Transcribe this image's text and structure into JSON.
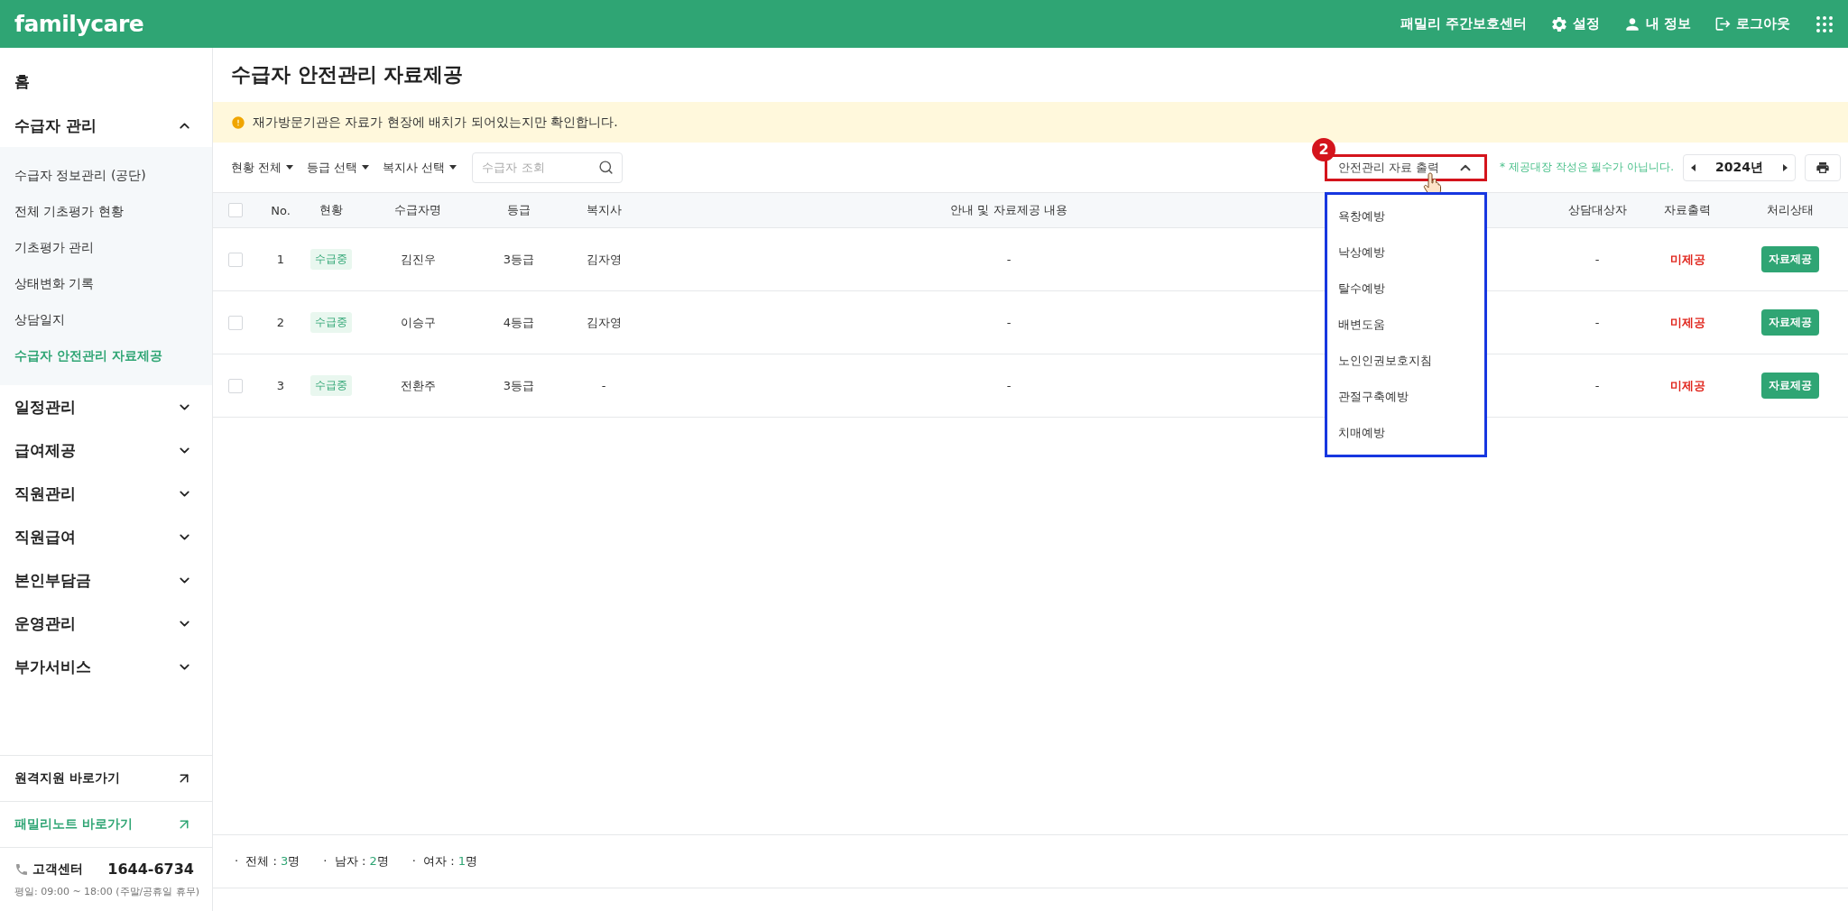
{
  "header": {
    "logo": "familycare",
    "center_name": "패밀리 주간보호센터",
    "actions": [
      {
        "kind": "settings",
        "label": "설정"
      },
      {
        "kind": "profile",
        "label": "내 정보"
      },
      {
        "kind": "logout",
        "label": "로그아웃"
      }
    ]
  },
  "sidebar": {
    "menu": [
      {
        "kind": "link",
        "label": "홈"
      },
      {
        "kind": "group",
        "label": "수급자 관리",
        "expanded": true,
        "children": [
          {
            "label": "수급자 정보관리 (공단)",
            "selected": false
          },
          {
            "label": "전체 기초평가 현황",
            "selected": false
          },
          {
            "label": "기초평가 관리",
            "selected": false
          },
          {
            "label": "상태변화 기록",
            "selected": false
          },
          {
            "label": "상담일지",
            "selected": false
          },
          {
            "label": "수급자 안전관리 자료제공",
            "selected": true
          }
        ]
      },
      {
        "kind": "group",
        "label": "일정관리",
        "expanded": false
      },
      {
        "kind": "group",
        "label": "급여제공",
        "expanded": false
      },
      {
        "kind": "group",
        "label": "직원관리",
        "expanded": false
      },
      {
        "kind": "group",
        "label": "직원급여",
        "expanded": false
      },
      {
        "kind": "group",
        "label": "본인부담금",
        "expanded": false
      },
      {
        "kind": "group",
        "label": "운영관리",
        "expanded": false
      },
      {
        "kind": "group",
        "label": "부가서비스",
        "expanded": false
      }
    ],
    "shortcuts": [
      {
        "label": "원격지원 바로가기",
        "highlighted": false
      },
      {
        "label": "패밀리노트 바로가기",
        "highlighted": true
      }
    ],
    "support": {
      "label": "고객센터",
      "phone": "1644-6734",
      "hours": "평일: 09:00 ~ 18:00 (주말/공휴일 휴무)"
    }
  },
  "page": {
    "title": "수급자 안전관리 자료제공",
    "notice": "재가방문기관은 자료가 현장에 배치가 되어있는지만 확인합니다."
  },
  "filters": [
    {
      "label": "현황 전체"
    },
    {
      "label": "등급 선택"
    },
    {
      "label": "복지사 선택"
    }
  ],
  "search": {
    "placeholder": "수급자 조회"
  },
  "output_dropdown": {
    "label": "안전관리 자료 출력",
    "expanded": true,
    "badge": "2",
    "options": [
      "욕창예방",
      "낙상예방",
      "탈수예방",
      "배변도움",
      "노인인권보호지침",
      "관절구축예방",
      "치매예방"
    ]
  },
  "note": "* 제공대장 작성은 필수가 아닙니다.",
  "year": "2024년",
  "table": {
    "header_checked": false,
    "columns": [
      "No.",
      "현황",
      "수급자명",
      "등급",
      "복지사",
      "안내 및 자료제공 내용",
      "상담대상자",
      "자료출력",
      "처리상태"
    ],
    "rows": [
      {
        "checked": false,
        "no": "1",
        "status": "수급중",
        "name": "김진우",
        "grade": "3등급",
        "worker": "김자영",
        "content": "-",
        "counsel": "-",
        "output": "미제공",
        "action": "자료제공"
      },
      {
        "checked": false,
        "no": "2",
        "status": "수급중",
        "name": "이승구",
        "grade": "4등급",
        "worker": "김자영",
        "content": "-",
        "counsel": "-",
        "output": "미제공",
        "action": "자료제공"
      },
      {
        "checked": false,
        "no": "3",
        "status": "수급중",
        "name": "전환주",
        "grade": "3등급",
        "worker": "-",
        "content": "-",
        "counsel": "-",
        "output": "미제공",
        "action": "자료제공"
      }
    ]
  },
  "summary": [
    {
      "bullet": "·",
      "label": "전체 :",
      "count": "3",
      "unit": "명"
    },
    {
      "bullet": "·",
      "label": "남자 :",
      "count": "2",
      "unit": "명"
    },
    {
      "bullet": "·",
      "label": "여자 :",
      "count": "1",
      "unit": "명"
    }
  ]
}
